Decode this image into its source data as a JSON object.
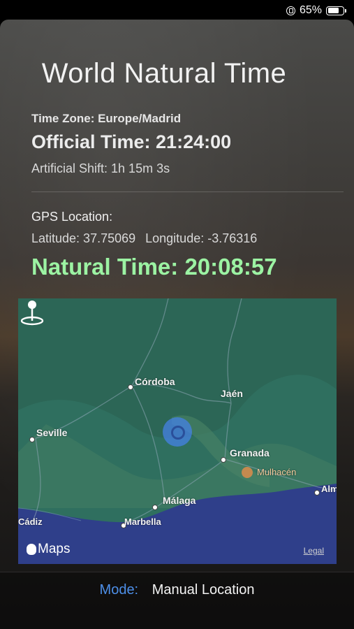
{
  "status_bar": {
    "battery": "65%",
    "icons": [
      "orientation-lock-icon",
      "battery-icon"
    ]
  },
  "header": {
    "title": "World Natural Time"
  },
  "time": {
    "time_zone": "Time Zone: Europe/Madrid",
    "official_time": "Official Time: 21:24:00",
    "artificial_shift": "Artificial Shift: 1h 15m 3s"
  },
  "gps": {
    "heading": "GPS Location:",
    "latitude": "Latitude: 37.75069",
    "longitude": "Longitude: -3.76316"
  },
  "natural_time": "Natural Time: 20:08:57",
  "map": {
    "cities": [
      "Córdoba",
      "Jaén",
      "Seville",
      "Granada",
      "Málaga",
      "Marbella",
      "Almería",
      "Cádiz"
    ],
    "landmark": "Mulhacén",
    "brand": "Maps",
    "legal": "Legal"
  },
  "mode": {
    "label": "Mode:",
    "value": "Manual Location"
  },
  "colors": {
    "natural_time": "#9cf3a3",
    "mode_label": "#4d8fe8",
    "map_land": "#2f6f5f",
    "map_sea": "#2f3f8a"
  }
}
